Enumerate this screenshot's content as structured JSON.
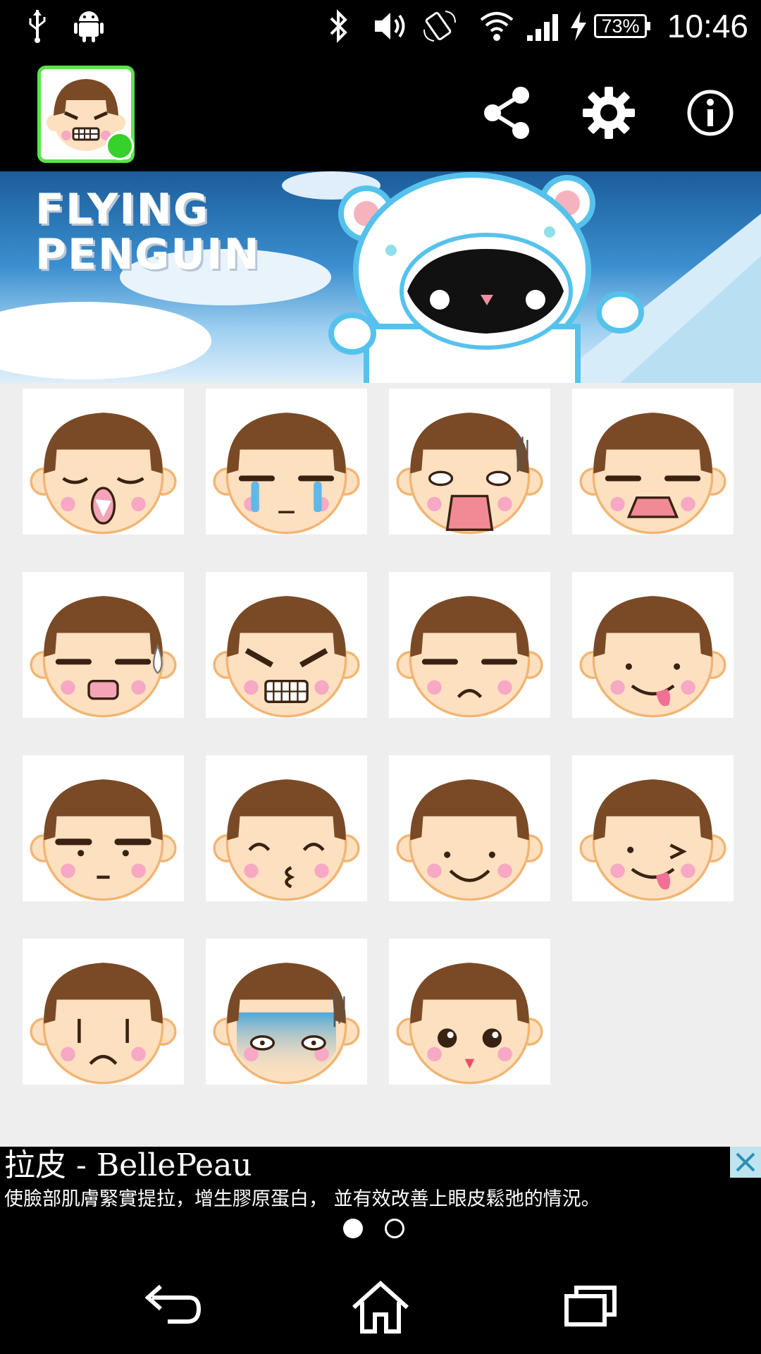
{
  "status_bar": {
    "battery": "73%",
    "time": "10:46",
    "left_icons": [
      "usb-icon",
      "android-icon"
    ],
    "right_icons": [
      "bluetooth-icon",
      "volume-icon",
      "rotate-icon",
      "wifi-icon",
      "signal-icon",
      "charging-icon"
    ]
  },
  "app_bar": {
    "actions": [
      "share-icon",
      "settings-icon",
      "info-icon"
    ]
  },
  "banner": {
    "title_line1": "FLYING",
    "title_line2": "PENGUIN"
  },
  "stickers": [
    {
      "expression": "sleepy-yawn"
    },
    {
      "expression": "crying"
    },
    {
      "expression": "shocked"
    },
    {
      "expression": "displeased-shout"
    },
    {
      "expression": "nervous-sweat"
    },
    {
      "expression": "angry-teeth"
    },
    {
      "expression": "unhappy"
    },
    {
      "expression": "tongue-out"
    },
    {
      "expression": "sulky"
    },
    {
      "expression": "kissy"
    },
    {
      "expression": "smile"
    },
    {
      "expression": "wink-tongue"
    },
    {
      "expression": "sad"
    },
    {
      "expression": "horrified"
    },
    {
      "expression": "cute-surprised"
    }
  ],
  "ad": {
    "title": "拉皮 - BellePeau",
    "body": "使臉部肌膚緊實提拉，增生膠原蛋白， 並有效改善上眼皮鬆弛的情況。",
    "page_count": 2,
    "active_page": 1
  },
  "nav_bar": {
    "buttons": [
      "back-icon",
      "home-icon",
      "recent-apps-icon"
    ]
  },
  "colors": {
    "app_icon_border": "#5be34a",
    "grid_background": "#eeeeee",
    "hair": "#7a4a26",
    "skin": "#fde0c0",
    "blush": "#f7a8c4"
  }
}
